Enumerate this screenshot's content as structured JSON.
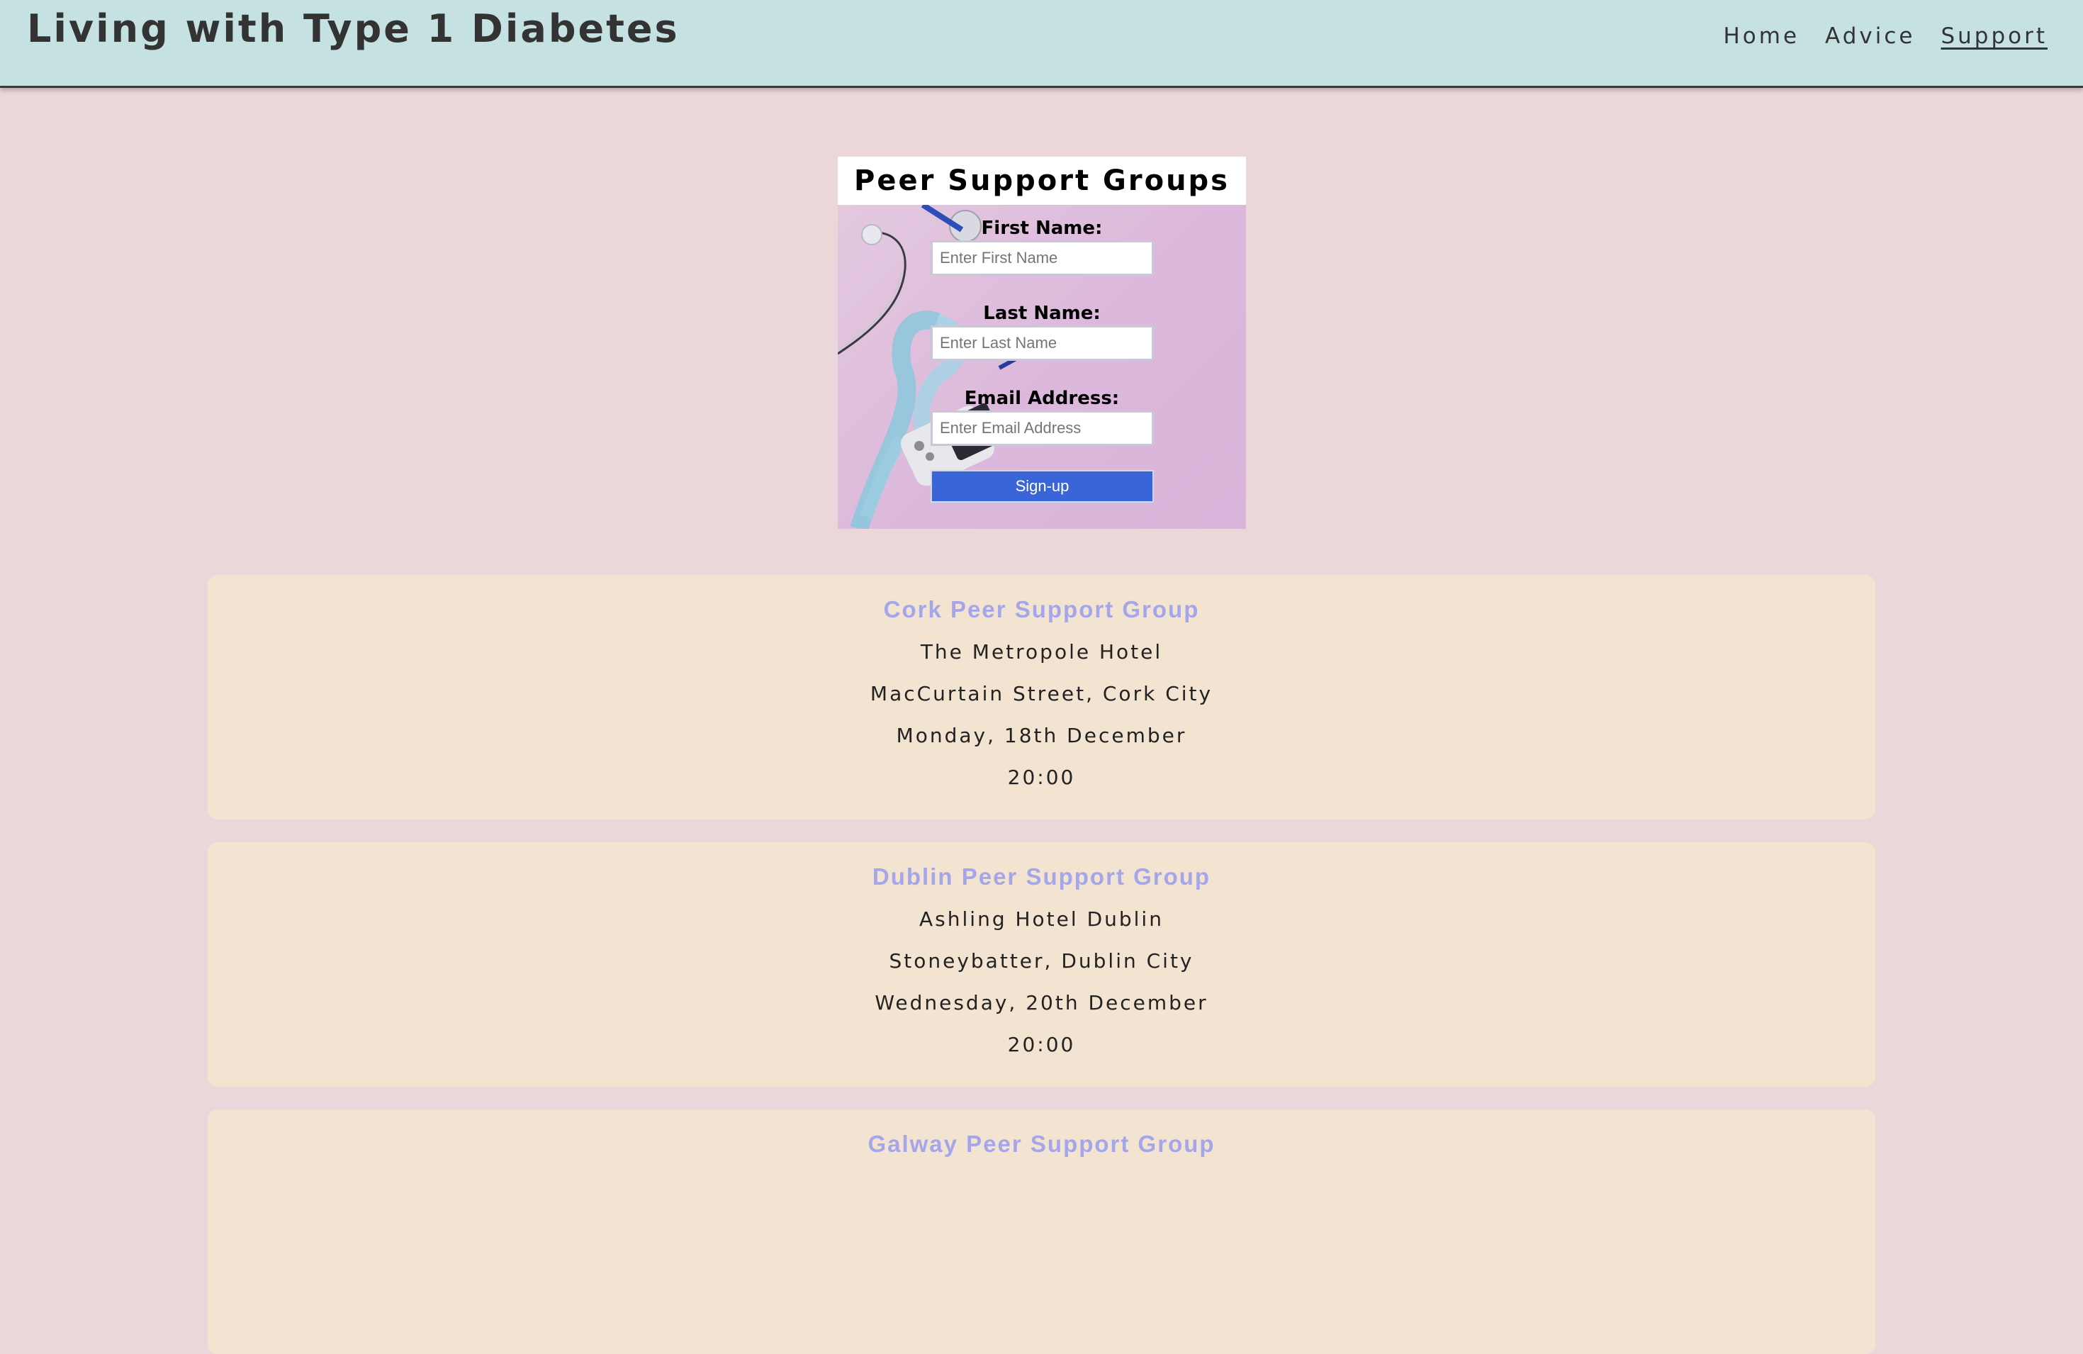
{
  "header": {
    "title": "Living with Type 1 Diabetes",
    "nav": [
      {
        "label": "Home",
        "active": false
      },
      {
        "label": "Advice",
        "active": false
      },
      {
        "label": "Support",
        "active": true
      }
    ]
  },
  "signup_form": {
    "heading": "Peer Support Groups",
    "first_name": {
      "label": "First Name:",
      "placeholder": "Enter First Name"
    },
    "last_name": {
      "label": "Last Name:",
      "placeholder": "Enter Last Name"
    },
    "email": {
      "label": "Email Address:",
      "placeholder": "Enter Email Address"
    },
    "submit_label": "Sign-up"
  },
  "groups": [
    {
      "title": "Cork Peer Support Group",
      "venue": "The Metropole Hotel",
      "address": "MacCurtain Street, Cork City",
      "date": "Monday, 18th December",
      "time": "20:00"
    },
    {
      "title": "Dublin Peer Support Group",
      "venue": "Ashling Hotel Dublin",
      "address": "Stoneybatter, Dublin City",
      "date": "Wednesday, 20th December",
      "time": "20:00"
    },
    {
      "title": "Galway Peer Support Group"
    }
  ],
  "colors": {
    "page_background": "#ebd6da",
    "header_background": "#c6e1e2",
    "card_background": "#f3e4d2",
    "group_title": "#a5a6ea",
    "button": "#3a65d8"
  }
}
